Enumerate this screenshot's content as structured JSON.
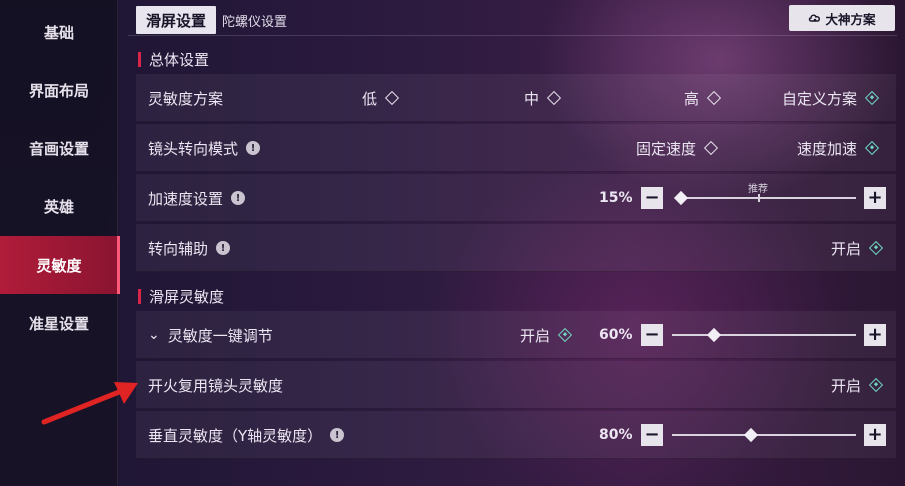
{
  "sidebar": {
    "items": [
      {
        "label": "基础"
      },
      {
        "label": "界面布局"
      },
      {
        "label": "音画设置"
      },
      {
        "label": "英雄"
      },
      {
        "label": "灵敏度"
      },
      {
        "label": "准星设置"
      }
    ]
  },
  "tabs": [
    {
      "label": "滑屏设置"
    },
    {
      "label": "陀螺仪设置"
    }
  ],
  "god_button": {
    "label": "大神方案",
    "icon": "cloud-link-icon"
  },
  "section_general": {
    "title": "总体设置",
    "sensitivity_plan": {
      "label": "灵敏度方案",
      "options": [
        "低",
        "中",
        "高",
        "自定义方案"
      ],
      "selected": "自定义方案"
    },
    "camera_mode": {
      "label": "镜头转向模式",
      "options": [
        "固定速度",
        "速度加速"
      ],
      "selected": "速度加速"
    },
    "acceleration": {
      "label": "加速度设置",
      "value": "15%",
      "recommend_label": "推荐",
      "level": 0.0
    },
    "turn_assist": {
      "label": "转向辅助",
      "state": "开启"
    }
  },
  "section_swipe": {
    "title": "滑屏灵敏度",
    "one_key": {
      "label": "灵敏度一键调节",
      "state": "开启",
      "value": "60%",
      "level": 0.2
    },
    "fire_reuse": {
      "label": "开火复用镜头灵敏度",
      "state": "开启"
    },
    "vertical": {
      "label": "垂直灵敏度（Y轴灵敏度）",
      "value": "80%",
      "level": 0.4
    }
  },
  "colors": {
    "accent_red": "#d8264a",
    "diamond_on": "#6fd6c0",
    "annotation_arrow": "#e02424"
  }
}
